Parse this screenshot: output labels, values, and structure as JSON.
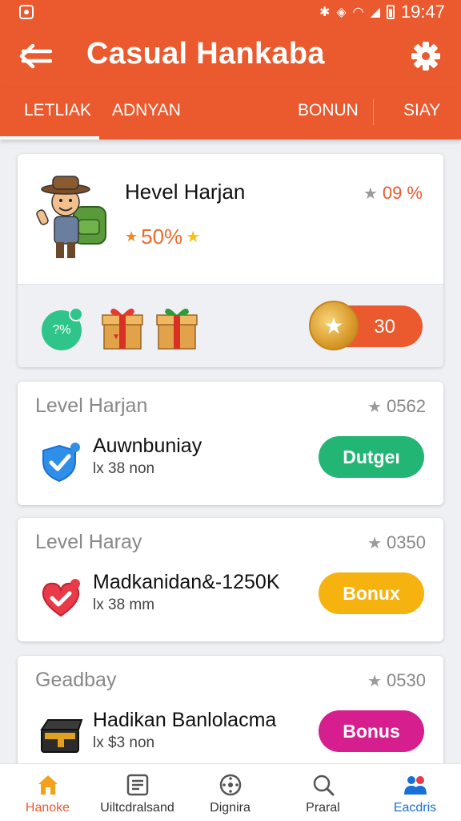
{
  "colors": {
    "brand": "#ea5a2e",
    "green": "#22b573",
    "yellow": "#f6b20f",
    "magenta": "#d61e8f",
    "blue_active": "#1a6fd6"
  },
  "status_bar": {
    "time": "19:47"
  },
  "header": {
    "title": "Casual Hankaba",
    "back_icon": "arrow-left-icon",
    "settings_icon": "gear-icon"
  },
  "tabs": [
    {
      "label": "LETLIAK",
      "active": true
    },
    {
      "label": "ADNYAN",
      "active": false
    },
    {
      "label": "BONUN",
      "active": false
    },
    {
      "label": "SIAY",
      "active": false
    }
  ],
  "hero": {
    "name": "Hevel Harjan",
    "rank": "09 %",
    "progress": "50%",
    "bubble_percent": "?%",
    "coin_count": "30"
  },
  "levels": [
    {
      "title": "Level Harjan",
      "score": "0562",
      "name": "Auwnbuniay",
      "sub": "lx 38 non",
      "button": "Dutgeı",
      "icon": "shield-check-icon"
    },
    {
      "title": "Level Haray",
      "score": "0350",
      "name": "Madkanidan&-1250K",
      "sub": "lx 38 mm",
      "button": "Bonux",
      "icon": "heart-check-icon"
    },
    {
      "title": "Geadbay",
      "score": "0530",
      "name": "Hadikan Banlolacma",
      "sub": "lx $3 non",
      "button": "Bonus",
      "icon": "treasure-chest-icon"
    }
  ],
  "bottom_nav": [
    {
      "label": "Hanoke",
      "icon": "home-icon",
      "active": true
    },
    {
      "label": "Uiltcdralsand",
      "icon": "list-icon",
      "active": false
    },
    {
      "label": "Dignira",
      "icon": "dial-icon",
      "active": false
    },
    {
      "label": "Praral",
      "icon": "search-icon",
      "active": false
    },
    {
      "label": "Eacdris",
      "icon": "people-icon",
      "active": false
    }
  ]
}
